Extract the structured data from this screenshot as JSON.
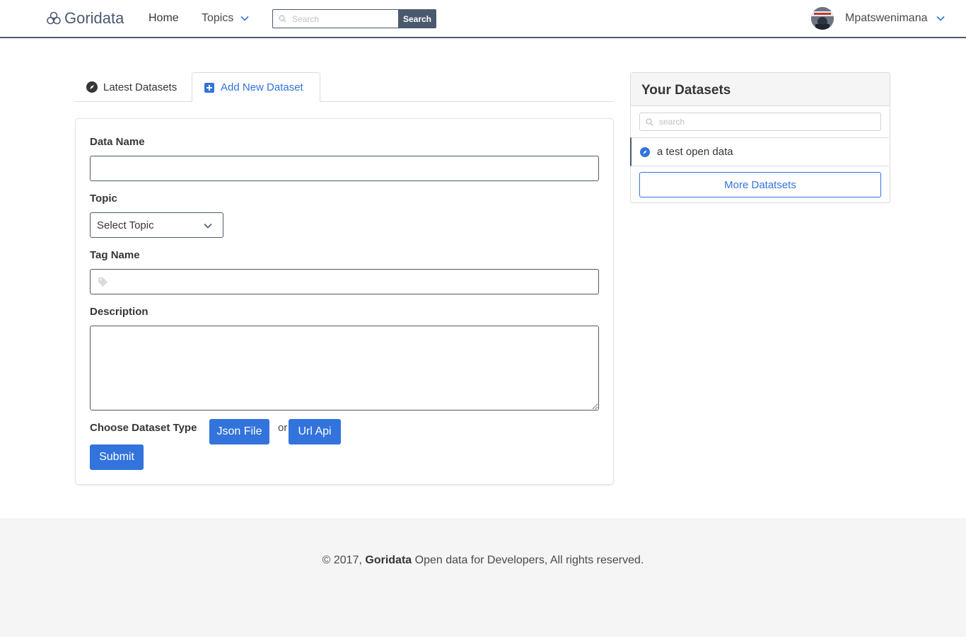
{
  "nav": {
    "brand": "Goridata",
    "home": "Home",
    "topics": "Topics",
    "search_placeholder": "Search",
    "search_button": "Search",
    "user_name": "Mpatswenimana"
  },
  "tabs": {
    "latest": "Latest Datasets",
    "add_new": "Add New Dataset"
  },
  "form": {
    "data_name_label": "Data Name",
    "data_name_value": "",
    "topic_label": "Topic",
    "topic_selected": "Select Topic",
    "tag_label": "Tag Name",
    "tag_value": "",
    "description_label": "Description",
    "description_value": "",
    "dataset_type_label": "Choose Dataset Type",
    "json_button": "Json File",
    "or_text": "or",
    "url_button": "Url Api",
    "submit_button": "Submit"
  },
  "sidebar": {
    "title": "Your Datasets",
    "search_placeholder": "search",
    "items": [
      {
        "label": "a test open data"
      }
    ],
    "more_button": "More Datatsets"
  },
  "footer": {
    "copyright": "© 2017,",
    "brand": "Goridata",
    "tagline": "Open data for Developers, All rights reserved."
  },
  "colors": {
    "primary": "#3273dc",
    "nav_dark": "#4a5a6e",
    "footer_bg": "#f5f5f5"
  }
}
